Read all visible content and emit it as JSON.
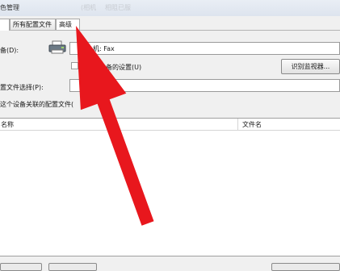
{
  "window": {
    "title_visible": "色管理",
    "title_faded_1": "(相机",
    "title_faded_2": "相阻已服"
  },
  "tabs": [
    {
      "label": ""
    },
    {
      "label": "所有配置文件"
    },
    {
      "label": "高级"
    }
  ],
  "device": {
    "label": "备(D):",
    "icon": "printer-icon",
    "selected_value": "机: Fax"
  },
  "checkbox": {
    "label": "对此设备的设置(U)"
  },
  "identify_button": {
    "label": "识别监视器..."
  },
  "profile_select": {
    "label": "置文件选择(P):",
    "value": ""
  },
  "associated_profiles": {
    "label": "这个设备关联的配置文件("
  },
  "list": {
    "columns": [
      "名称",
      "文件名"
    ]
  },
  "annotation": {
    "color": "#e8171d"
  }
}
